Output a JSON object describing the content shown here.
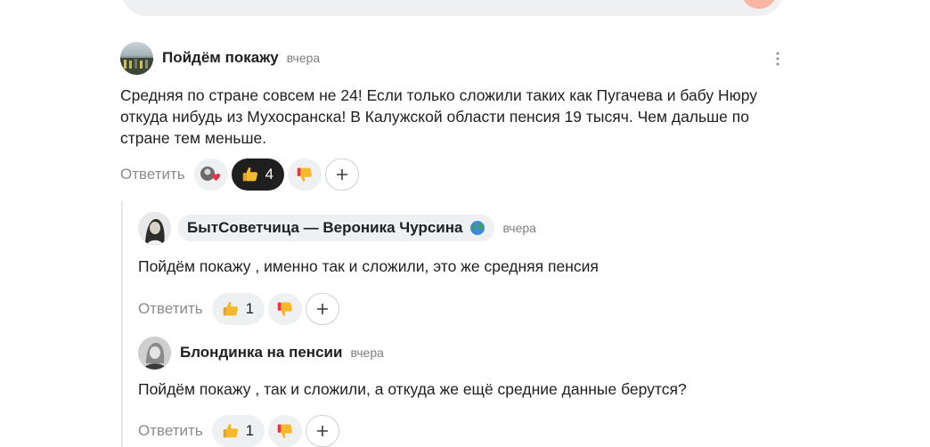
{
  "comments": [
    {
      "author": "Пойдём покажу",
      "time": "вчера",
      "text": "Средняя по стране совсем не 24! Если только сложили таких как Пугачева и бабу Нюру откуда нибудь из Мухосранска! В Калужской области пенсия 19 тысяч. Чем дальше по стране тем меньше.",
      "reply_label": "Ответить",
      "likes": "4"
    }
  ],
  "replies": [
    {
      "author": "БытСоветчица — Вероника Чурсина",
      "time": "вчера",
      "text": "Пойдём покажу , именно так и сложили, это же средняя пенсия",
      "reply_label": "Ответить",
      "likes": "1"
    },
    {
      "author": "Блондинка на пенсии",
      "time": "вчера",
      "text": "Пойдём покажу , так и сложили, а откуда же ещё средние данные берутся?",
      "reply_label": "Ответить",
      "likes": "1"
    }
  ],
  "icons": {
    "like": "thumbs-up-icon",
    "dislike": "thumbs-down-icon",
    "add_reaction": "plus-icon",
    "menu": "more-vertical-icon",
    "globe": "globe-icon"
  },
  "colors": {
    "accent_send": "#f6b6a3",
    "pill_bg": "#eff0f2",
    "pill_dark": "#1f1f1f",
    "muted_text": "#8a8a8a"
  }
}
